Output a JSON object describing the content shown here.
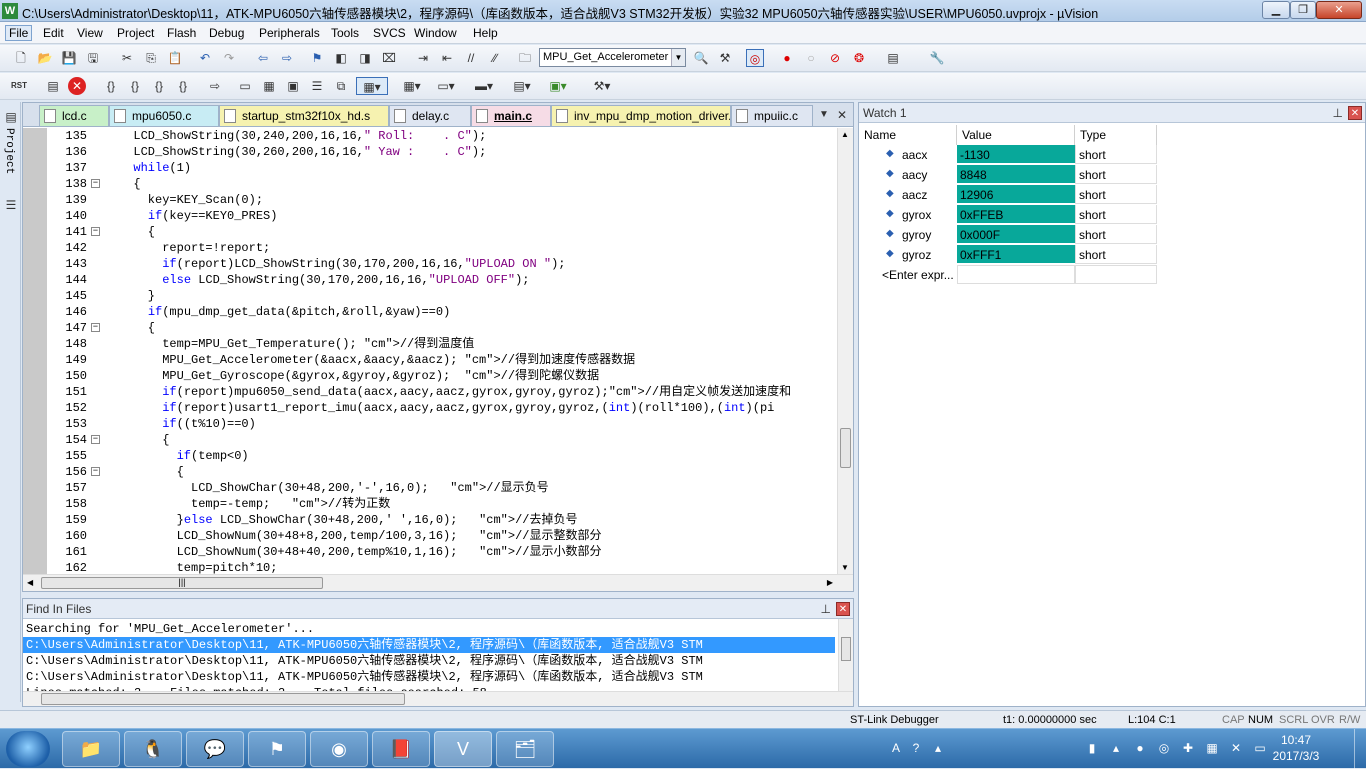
{
  "window": {
    "title": "C:\\Users\\Administrator\\Desktop\\11，ATK-MPU6050六轴传感器模块\\2，程序源码\\（库函数版本，适合战舰V3 STM32开发板）实验32 MPU6050六轴传感器实验\\USER\\MPU6050.uvprojx - µVision",
    "min": "▁",
    "max": "❐",
    "close": "✕"
  },
  "menu": [
    "File",
    "Edit",
    "View",
    "Project",
    "Flash",
    "Debug",
    "Peripherals",
    "Tools",
    "SVCS",
    "Window",
    "Help"
  ],
  "toolbar": {
    "target_combo": "MPU_Get_Accelerometer"
  },
  "project_strip": {
    "label": "Project"
  },
  "tabs": [
    {
      "label": "lcd.c",
      "color": "#c8f0c8"
    },
    {
      "label": "mpu6050.c",
      "color": "#c8ecf4"
    },
    {
      "label": "startup_stm32f10x_hd.s",
      "color": "#f6f2b0"
    },
    {
      "label": "delay.c",
      "color": "#dfe6f2"
    },
    {
      "label": "main.c",
      "color": "#f6dce6"
    },
    {
      "label": "inv_mpu_dmp_motion_driver.c",
      "color": "#f6f2b0"
    },
    {
      "label": "mpuiic.c",
      "color": "#dfe6f2"
    }
  ],
  "code": [
    {
      "n": "135",
      "t": "  LCD_ShowString(30,240,200,16,16,\" Roll:    . C\");"
    },
    {
      "n": "136",
      "t": "  LCD_ShowString(30,260,200,16,16,\" Yaw :    . C\");"
    },
    {
      "n": "137",
      "t": "  while(1)"
    },
    {
      "n": "138",
      "t": "  {"
    },
    {
      "n": "139",
      "t": "    key=KEY_Scan(0);"
    },
    {
      "n": "140",
      "t": "    if(key==KEY0_PRES)"
    },
    {
      "n": "141",
      "t": "    {"
    },
    {
      "n": "142",
      "t": "      report=!report;"
    },
    {
      "n": "143",
      "t": "      if(report)LCD_ShowString(30,170,200,16,16,\"UPLOAD ON \");"
    },
    {
      "n": "144",
      "t": "      else LCD_ShowString(30,170,200,16,16,\"UPLOAD OFF\");"
    },
    {
      "n": "145",
      "t": "    }"
    },
    {
      "n": "146",
      "t": "    if(mpu_dmp_get_data(&pitch,&roll,&yaw)==0)"
    },
    {
      "n": "147",
      "t": "    {"
    },
    {
      "n": "148",
      "t": "      temp=MPU_Get_Temperature(); //得到温度值"
    },
    {
      "n": "149",
      "t": "      MPU_Get_Accelerometer(&aacx,&aacy,&aacz); //得到加速度传感器数据"
    },
    {
      "n": "150",
      "t": "      MPU_Get_Gyroscope(&gyrox,&gyroy,&gyroz);  //得到陀螺仪数据"
    },
    {
      "n": "151",
      "t": "      if(report)mpu6050_send_data(aacx,aacy,aacz,gyrox,gyroy,gyroz);//用自定义帧发送加速度和"
    },
    {
      "n": "152",
      "t": "      if(report)usart1_report_imu(aacx,aacy,aacz,gyrox,gyroy,gyroz,(int)(roll*100),(int)(pi"
    },
    {
      "n": "153",
      "t": "      if((t%10)==0)"
    },
    {
      "n": "154",
      "t": "      {"
    },
    {
      "n": "155",
      "t": "        if(temp<0)"
    },
    {
      "n": "156",
      "t": "        {"
    },
    {
      "n": "157",
      "t": "          LCD_ShowChar(30+48,200,'-',16,0);   //显示负号"
    },
    {
      "n": "158",
      "t": "          temp=-temp;   //转为正数"
    },
    {
      "n": "159",
      "t": "        }else LCD_ShowChar(30+48,200,' ',16,0);   //去掉负号"
    },
    {
      "n": "160",
      "t": "        LCD_ShowNum(30+48+8,200,temp/100,3,16);   //显示整数部分"
    },
    {
      "n": "161",
      "t": "        LCD_ShowNum(30+48+40,200,temp%10,1,16);   //显示小数部分"
    },
    {
      "n": "162",
      "t": "        temp=pitch*10;"
    }
  ],
  "watch": {
    "title": "Watch 1",
    "cols": [
      "Name",
      "Value",
      "Type"
    ],
    "rows": [
      {
        "name": "aacx",
        "value": "-1130",
        "type": "short"
      },
      {
        "name": "aacy",
        "value": "8848",
        "type": "short"
      },
      {
        "name": "aacz",
        "value": "12906",
        "type": "short"
      },
      {
        "name": "gyrox",
        "value": "0xFFEB",
        "type": "short"
      },
      {
        "name": "gyroy",
        "value": "0x000F",
        "type": "short"
      },
      {
        "name": "gyroz",
        "value": "0xFFF1",
        "type": "short"
      }
    ],
    "enter": "<Enter expr..."
  },
  "find": {
    "title": "Find In Files",
    "lines": [
      "Searching for 'MPU_Get_Accelerometer'...",
      "C:\\Users\\Administrator\\Desktop\\11, ATK-MPU6050六轴传感器模块\\2, 程序源码\\（库函数版本, 适合战舰V3 STM",
      "C:\\Users\\Administrator\\Desktop\\11, ATK-MPU6050六轴传感器模块\\2, 程序源码\\（库函数版本, 适合战舰V3 STM",
      "C:\\Users\\Administrator\\Desktop\\11, ATK-MPU6050六轴传感器模块\\2, 程序源码\\（库函数版本, 适合战舰V3 STM",
      "Lines matched: 3    Files matched: 2    Total files searched: 58"
    ]
  },
  "status": {
    "debugger": "ST-Link Debugger",
    "time": "t1: 0.00000000 sec",
    "pos": "L:104 C:1",
    "cap": "CAP",
    "num": "NUM",
    "scrl": "SCRL",
    "ovr": "OVR",
    "rw": "R/W"
  },
  "taskbar": {
    "time": "10:47",
    "date": "2017/3/3"
  }
}
